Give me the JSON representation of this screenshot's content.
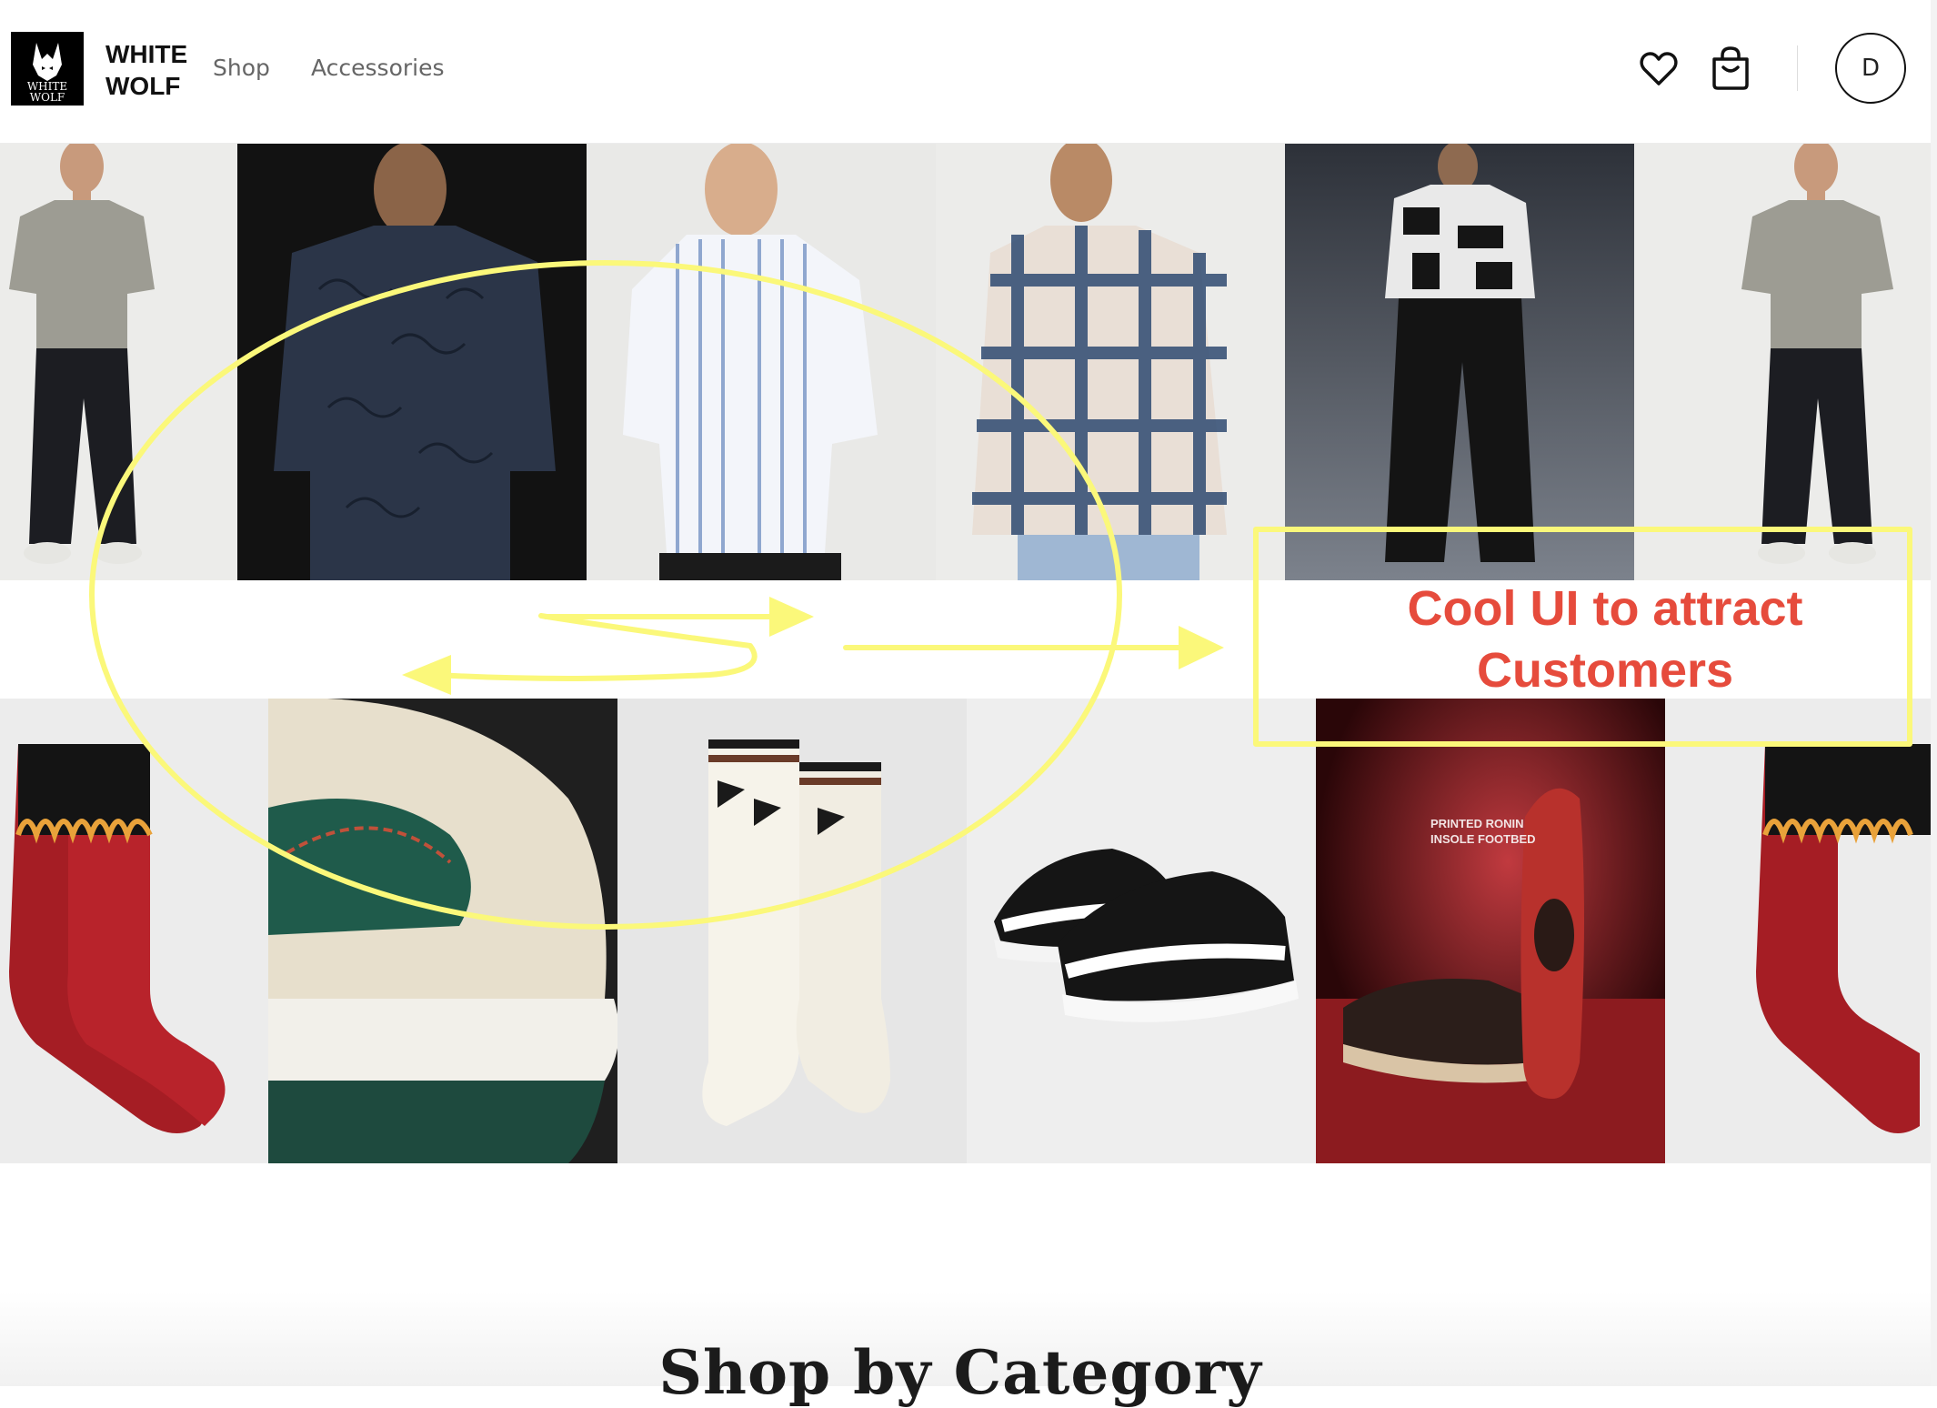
{
  "header": {
    "logo": {
      "line1": "WHITE",
      "line2": "WOLF",
      "icon": "wolf-head-icon"
    },
    "brand_line1": "WHITE",
    "brand_line2": "WOLF",
    "nav": [
      {
        "label": "Shop"
      },
      {
        "label": "Accessories"
      }
    ],
    "icons": {
      "wishlist": "heart-icon",
      "cart": "shopping-bag-icon"
    },
    "avatar_initial": "D"
  },
  "hero_rows": [
    {
      "items": [
        "grey-knit-polo",
        "navy-printed-shirt",
        "striped-shirt",
        "plaid-shirt",
        "graphic-print-shirt",
        "grey-knit-polo"
      ]
    },
    {
      "items": [
        "flame-socks",
        "sneaker-closeup",
        "white-socks",
        "black-white-sneakers",
        "printed-ronin-sneakers",
        "flame-socks"
      ]
    }
  ],
  "product_image_text": {
    "line1": "PRINTED RONIN",
    "line2": "INSOLE FOOTBED"
  },
  "section": {
    "title": "Shop by Category"
  },
  "annotation": {
    "line1": "Cool UI to attract",
    "line2": "Customers",
    "colors": {
      "highlight": "#fbf87a",
      "text": "#e64b3c"
    }
  }
}
